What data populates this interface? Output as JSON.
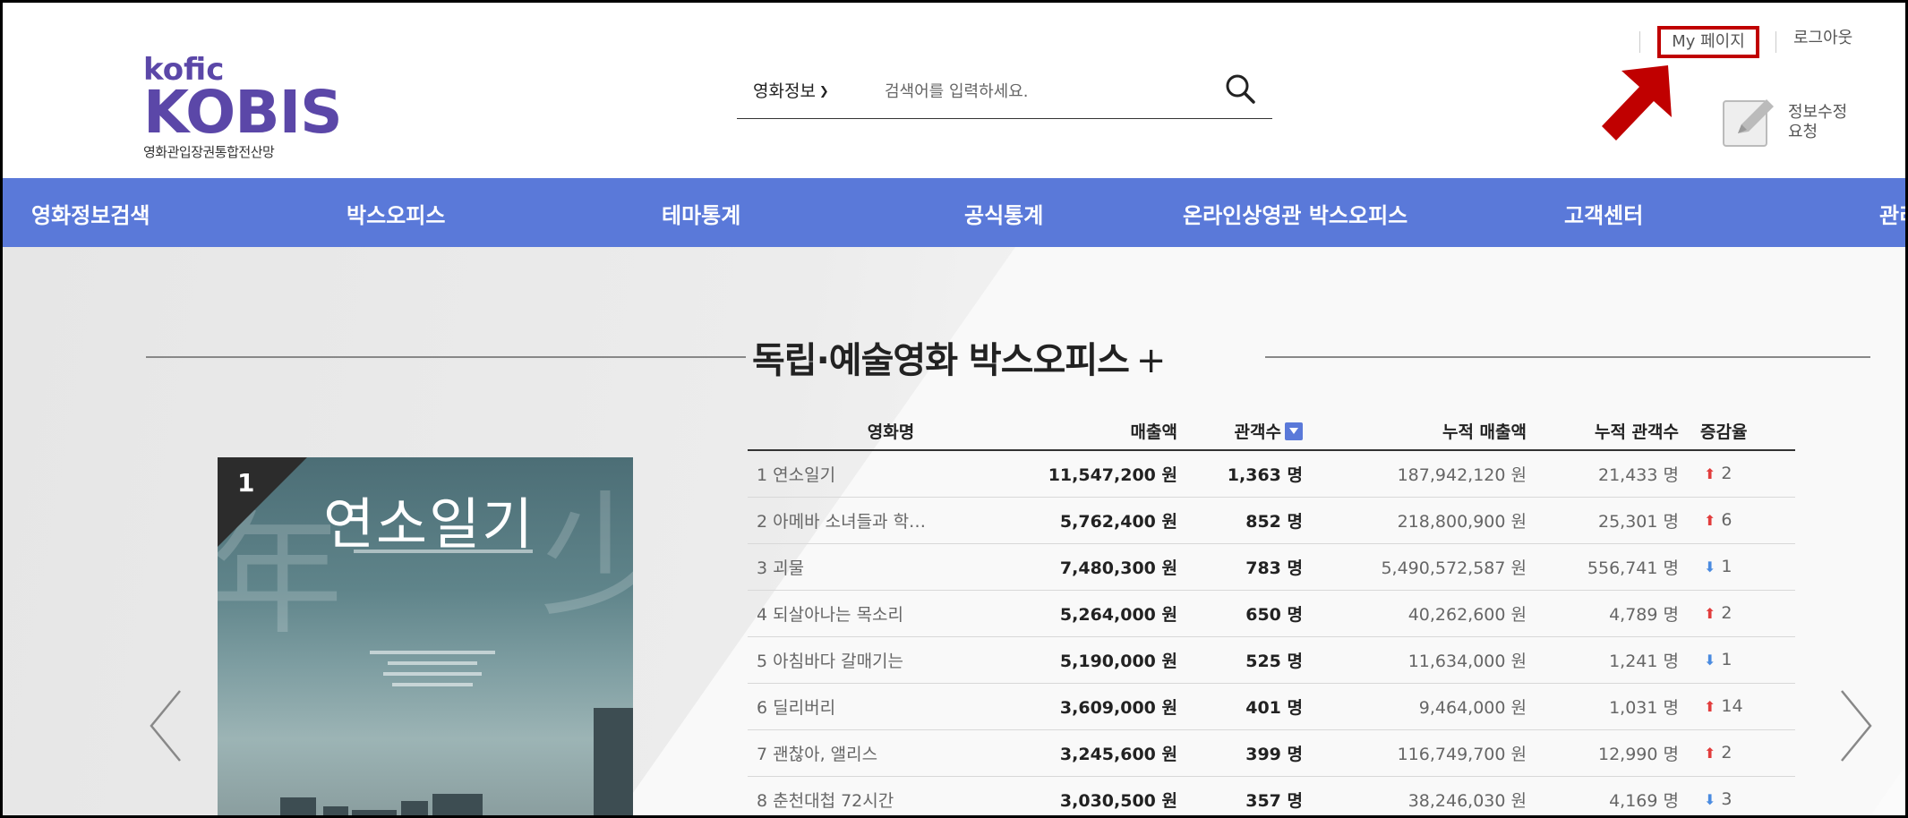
{
  "header": {
    "logo_top": "kofic",
    "logo_main": "KOBIS",
    "logo_sub": "영화관입장권통합전산망",
    "search_category": "영화정보",
    "search_placeholder": "검색어를 입력하세요.",
    "my_page": "My 페이지",
    "logout": "로그아웃",
    "edit_info": "정보수정 요청"
  },
  "nav": {
    "items": [
      "영화정보검색",
      "박스오피스",
      "테마통계",
      "공식통계",
      "온라인상영관 박스오피스",
      "고객센터",
      "관리"
    ]
  },
  "section": {
    "title": "독립·예술영화 박스오피스",
    "plus": "+"
  },
  "poster": {
    "rank": "1",
    "title": "연소일기",
    "char_left": "年",
    "char_right": "少"
  },
  "table": {
    "headers": [
      "영화명",
      "매출액",
      "관객수",
      "누적 매출액",
      "누적 관객수",
      "증감율"
    ],
    "rows": [
      {
        "name": "1 연소일기",
        "sales": "11,547,200 원",
        "audience": "1,363 명",
        "acc_sales": "187,942,120 원",
        "acc_audience": "21,433 명",
        "dir": "up",
        "change": "2"
      },
      {
        "name": "2 아메바 소녀들과 학…",
        "sales": "5,762,400 원",
        "audience": "852 명",
        "acc_sales": "218,800,900 원",
        "acc_audience": "25,301 명",
        "dir": "up",
        "change": "6"
      },
      {
        "name": "3 괴물",
        "sales": "7,480,300 원",
        "audience": "783 명",
        "acc_sales": "5,490,572,587 원",
        "acc_audience": "556,741 명",
        "dir": "down",
        "change": "1"
      },
      {
        "name": "4 되살아나는 목소리",
        "sales": "5,264,000 원",
        "audience": "650 명",
        "acc_sales": "40,262,600 원",
        "acc_audience": "4,789 명",
        "dir": "up",
        "change": "2"
      },
      {
        "name": "5 아침바다 갈매기는",
        "sales": "5,190,000 원",
        "audience": "525 명",
        "acc_sales": "11,634,000 원",
        "acc_audience": "1,241 명",
        "dir": "down",
        "change": "1"
      },
      {
        "name": "6 딜리버리",
        "sales": "3,609,000 원",
        "audience": "401 명",
        "acc_sales": "9,464,000 원",
        "acc_audience": "1,031 명",
        "dir": "up",
        "change": "14"
      },
      {
        "name": "7 괜찮아, 앨리스",
        "sales": "3,245,600 원",
        "audience": "399 명",
        "acc_sales": "116,749,700 원",
        "acc_audience": "12,990 명",
        "dir": "up",
        "change": "2"
      },
      {
        "name": "8 춘천대첩 72시간",
        "sales": "3,030,500 원",
        "audience": "357 명",
        "acc_sales": "38,246,030 원",
        "acc_audience": "4,169 명",
        "dir": "down",
        "change": "3"
      }
    ]
  },
  "colors": {
    "nav_bg": "#5a79d9",
    "logo": "#5b47a8",
    "highlight": "#c00000",
    "up": "#e23d3d",
    "down": "#4a8be0"
  }
}
